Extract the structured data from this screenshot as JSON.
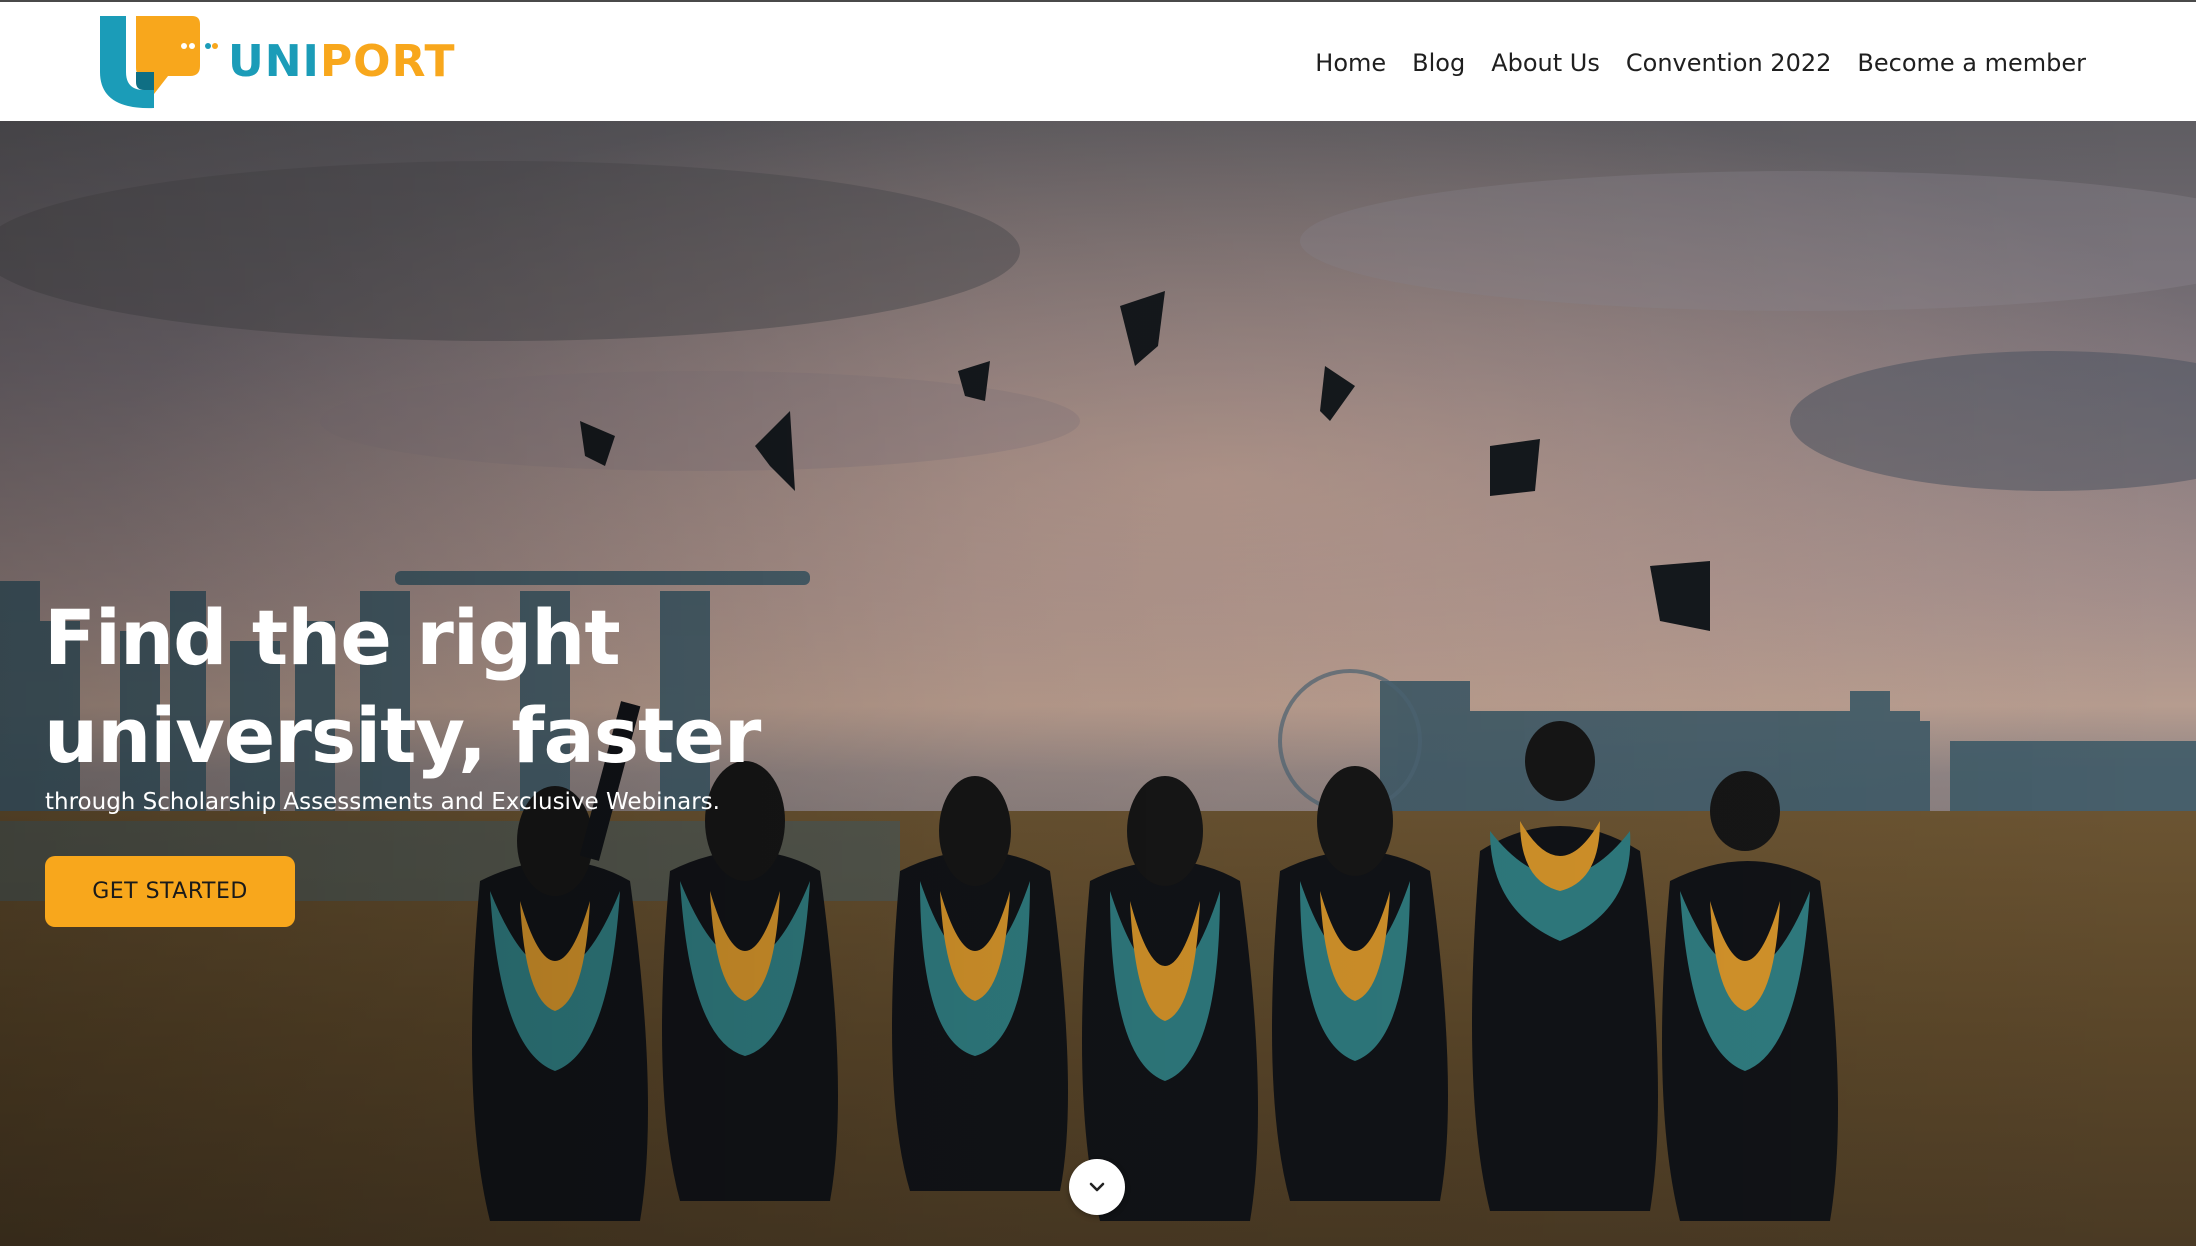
{
  "brand": {
    "name_part1": "UNI",
    "name_part2": "PORT",
    "colors": {
      "teal": "#1b9cb8",
      "orange": "#f8a71c"
    }
  },
  "nav": {
    "items": [
      {
        "label": "Home"
      },
      {
        "label": "Blog"
      },
      {
        "label": "About Us"
      },
      {
        "label": "Convention 2022"
      },
      {
        "label": "Become a member"
      }
    ]
  },
  "hero": {
    "title": "Find the right university, faster",
    "subtitle": "through Scholarship Assessments and Exclusive Webinars.",
    "cta_label": "GET STARTED",
    "scroll_icon": "chevron-down-icon",
    "background": "graduates-tossing-caps-photo"
  }
}
